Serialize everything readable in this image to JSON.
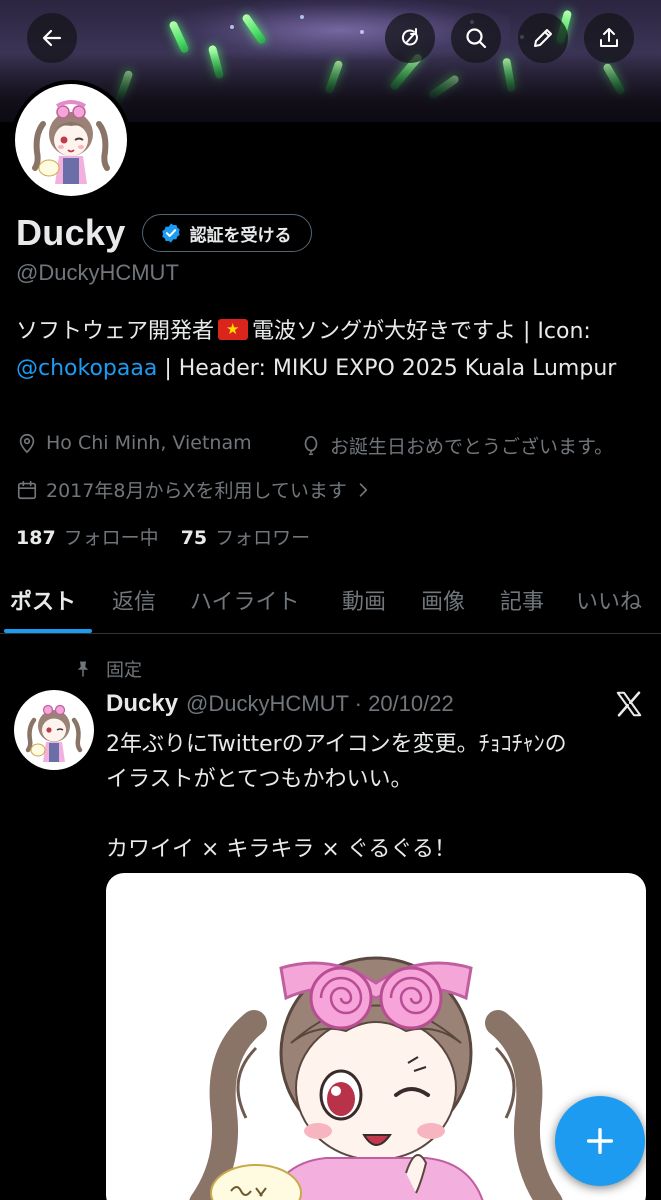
{
  "header": {
    "back_icon": "arrow-left-icon",
    "actions": [
      "refresh-icon",
      "search-icon",
      "pencil-icon",
      "share-icon"
    ]
  },
  "profile": {
    "name": "Ducky",
    "verify_label": "認証を受ける",
    "handle": "@DuckyHCMUT",
    "bio_part1": "ソフトウェア開発者",
    "bio_part2": "電波ソングが大好きですよ | Icon: ",
    "bio_link": "@chokopaaa",
    "bio_part3": " | Header: MIKU EXPO 2025 Kuala Lumpur",
    "location": "Ho Chi Minh, Vietnam",
    "birthday": "お誕生日おめでとうございます。",
    "joined": "2017年8月からXを利用しています",
    "following_count": "187",
    "following_label": "フォロー中",
    "followers_count": "75",
    "followers_label": "フォロワー"
  },
  "tabs": [
    {
      "label": "ポスト",
      "active": true
    },
    {
      "label": "返信"
    },
    {
      "label": "ハイライト"
    },
    {
      "label": "動画"
    },
    {
      "label": "画像"
    },
    {
      "label": "記事"
    },
    {
      "label": "いいね"
    }
  ],
  "post": {
    "pinned_label": "固定",
    "name": "Ducky",
    "handle_date": "@DuckyHCMUT · 20/10/22",
    "lines": [
      "2年ぶりにTwitterのアイコンを変更。ﾁｮｺﾁｬﾝの",
      "イラストがとてつもかわいい。",
      "",
      "カワイイ × キラキラ × ぐるぐる！"
    ]
  },
  "colors": {
    "accent": "#1d9bf0",
    "muted": "#71767b",
    "text": "#e7e9ea",
    "background": "#000000"
  }
}
